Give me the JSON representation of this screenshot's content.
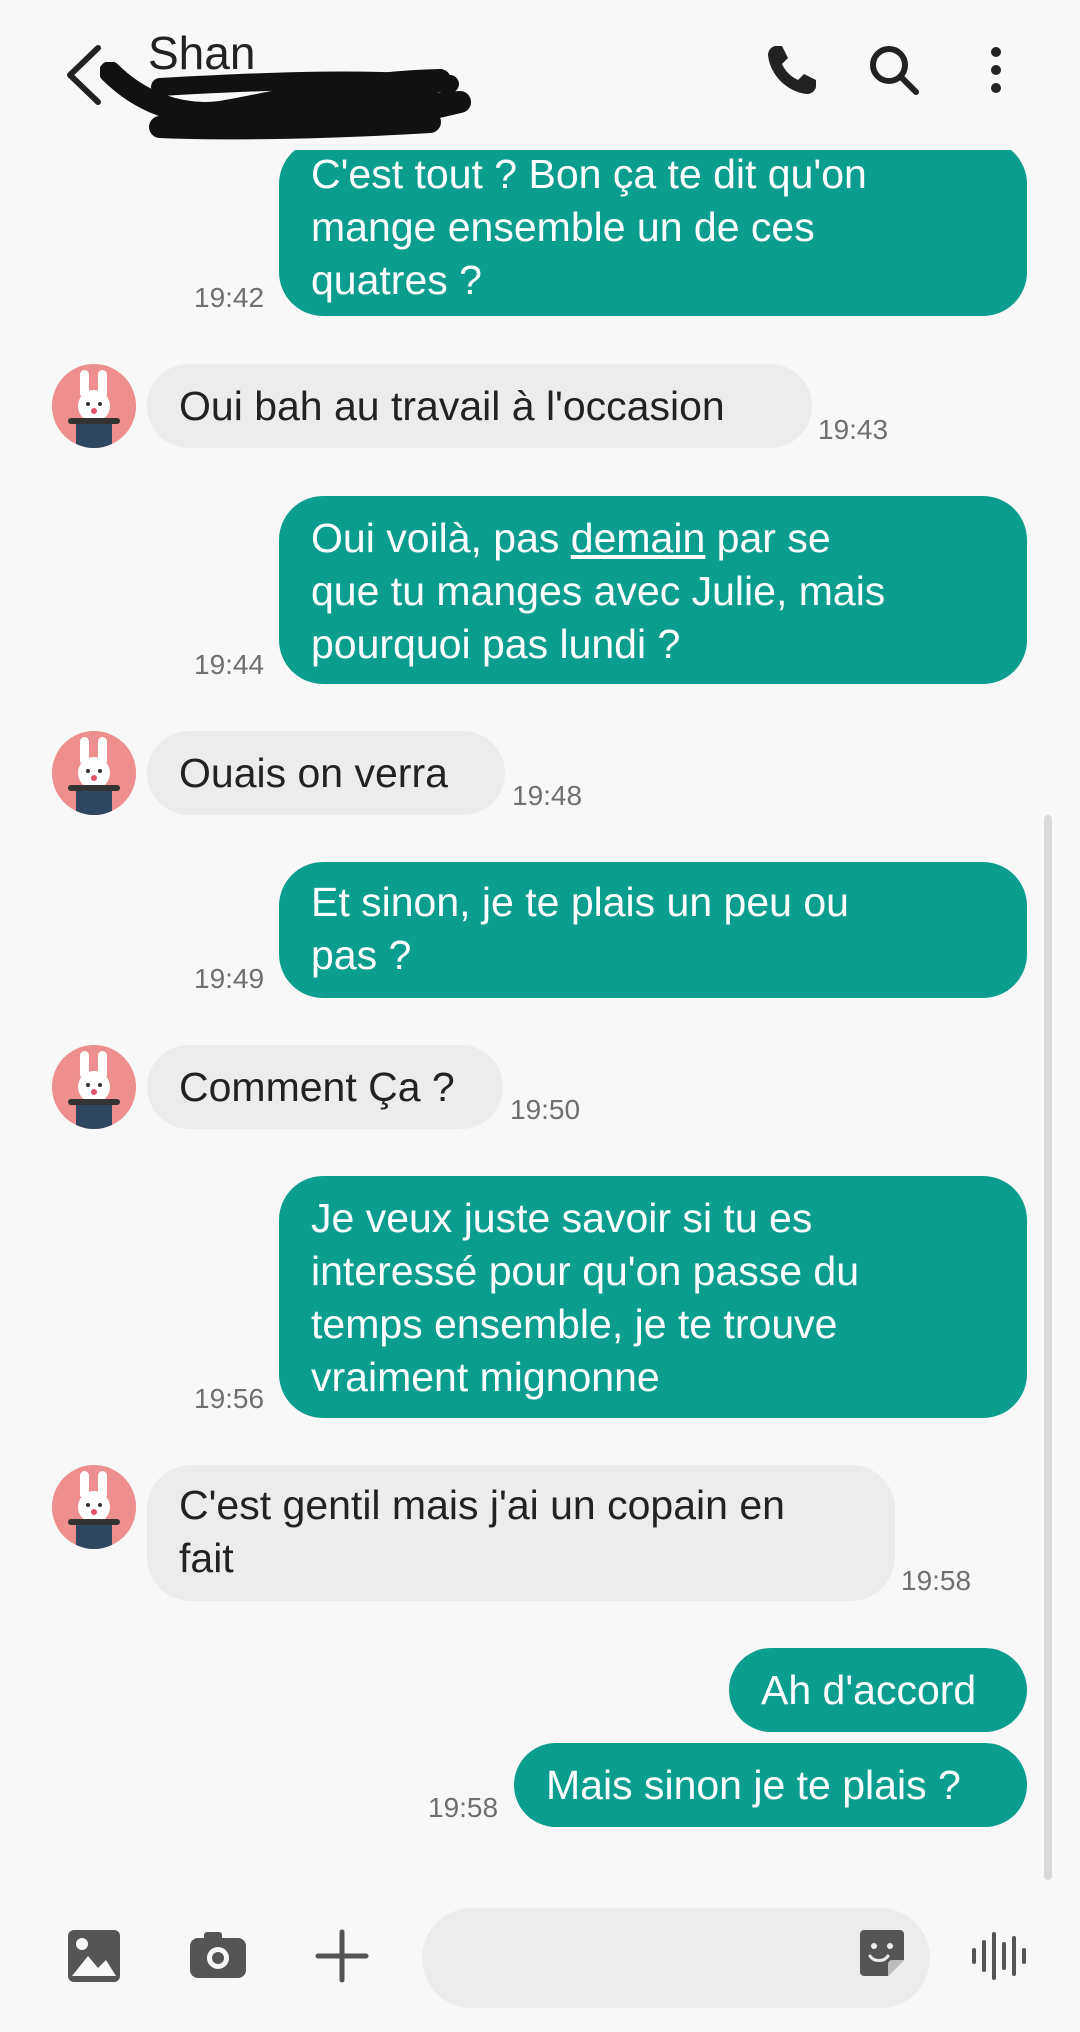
{
  "header": {
    "contact_name": "Shan",
    "icons": [
      "back-arrow-icon",
      "phone-icon",
      "search-icon",
      "more-vertical-icon"
    ]
  },
  "messages": [
    {
      "id": 0,
      "direction": "out",
      "text": "C'est tout ? Bon ça te dit qu'on\nmange ensemble un de ces\nquatres ?",
      "time": "19:42"
    },
    {
      "id": 1,
      "direction": "in",
      "text": "Oui bah au travail à l'occasion",
      "time": "19:43"
    },
    {
      "id": 2,
      "direction": "out",
      "text_before": "Oui voilà, pas ",
      "text_link": "demain",
      "text_after": " par se\nque tu manges avec Julie, mais\npourquoi pas lundi ?",
      "time": "19:44"
    },
    {
      "id": 3,
      "direction": "in",
      "text": "Ouais on verra",
      "time": "19:48"
    },
    {
      "id": 4,
      "direction": "out",
      "text": "Et sinon, je te plais un peu ou\npas ?",
      "time": "19:49"
    },
    {
      "id": 5,
      "direction": "in",
      "text": "Comment Ça ?",
      "time": "19:50"
    },
    {
      "id": 6,
      "direction": "out",
      "text": "Je veux juste savoir si tu es\ninteressé pour qu'on passe du\ntemps ensemble, je te trouve\nvraiment mignonne",
      "time": "19:56"
    },
    {
      "id": 7,
      "direction": "in",
      "text": "C'est gentil mais j'ai un copain en\nfait",
      "time": "19:58"
    },
    {
      "id": 8,
      "direction": "out",
      "text": "Ah d'accord",
      "time": ""
    },
    {
      "id": 9,
      "direction": "out",
      "text": "Mais sinon je te plais ?",
      "time": "19:58"
    }
  ],
  "composer": {
    "placeholder": "",
    "icons": [
      "gallery-icon",
      "camera-icon",
      "add-icon",
      "sticker-icon",
      "voice-icon"
    ]
  },
  "colors": {
    "outgoing_bubble": "#0b9e8e",
    "incoming_bubble": "#ececec",
    "background": "#f8f8f8",
    "avatar": "#ee8f8f"
  }
}
